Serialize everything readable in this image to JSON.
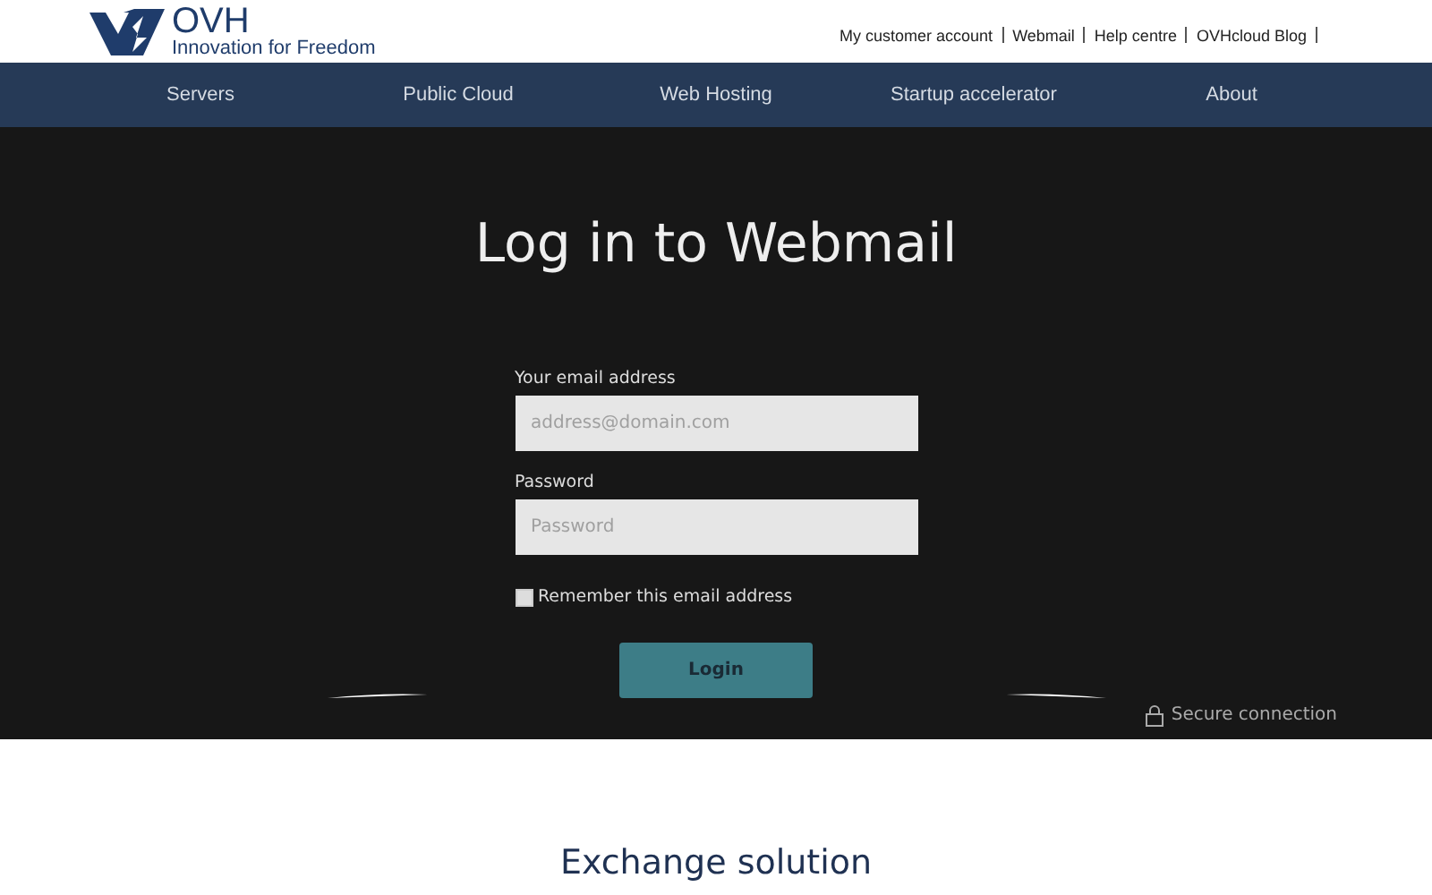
{
  "header": {
    "logo": {
      "name": "OVH",
      "tagline": "Innovation for Freedom"
    },
    "top_links": [
      "My customer account",
      "Webmail",
      "Help centre",
      "OVHcloud Blog"
    ]
  },
  "nav": {
    "items": [
      "Servers",
      "Public Cloud",
      "Web Hosting",
      "Startup accelerator",
      "About"
    ]
  },
  "login": {
    "title": "Log in to Webmail",
    "email": {
      "label": "Your email address",
      "placeholder": "address@domain.com"
    },
    "password": {
      "label": "Password",
      "placeholder": "Password"
    },
    "remember": {
      "label": "Remember this email address",
      "checked": false
    },
    "button": "Login",
    "secure": "Secure connection"
  },
  "section": {
    "title": "Exchange solution"
  }
}
